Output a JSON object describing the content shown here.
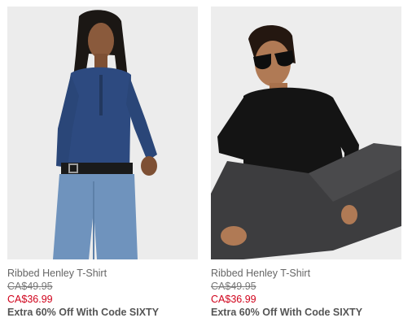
{
  "products": [
    {
      "name": "Ribbed Henley T-Shirt",
      "original_price": "CA$49.95",
      "sale_price": "CA$36.99",
      "promo": "Extra 60% Off With Code SIXTY",
      "image_alt": "Model wearing navy ribbed henley with jeans",
      "colors": {
        "shirt": "#2d4a80",
        "background": "#ececec"
      }
    },
    {
      "name": "Ribbed Henley T-Shirt",
      "original_price": "CA$49.95",
      "sale_price": "CA$36.99",
      "promo": "Extra 60% Off With Code SIXTY",
      "image_alt": "Model wearing black ribbed henley with sunglasses",
      "colors": {
        "shirt": "#141414",
        "background": "#ededed"
      }
    }
  ],
  "colors": {
    "sale": "#d0021b",
    "text": "#666666",
    "strike": "#7a7a7a"
  }
}
